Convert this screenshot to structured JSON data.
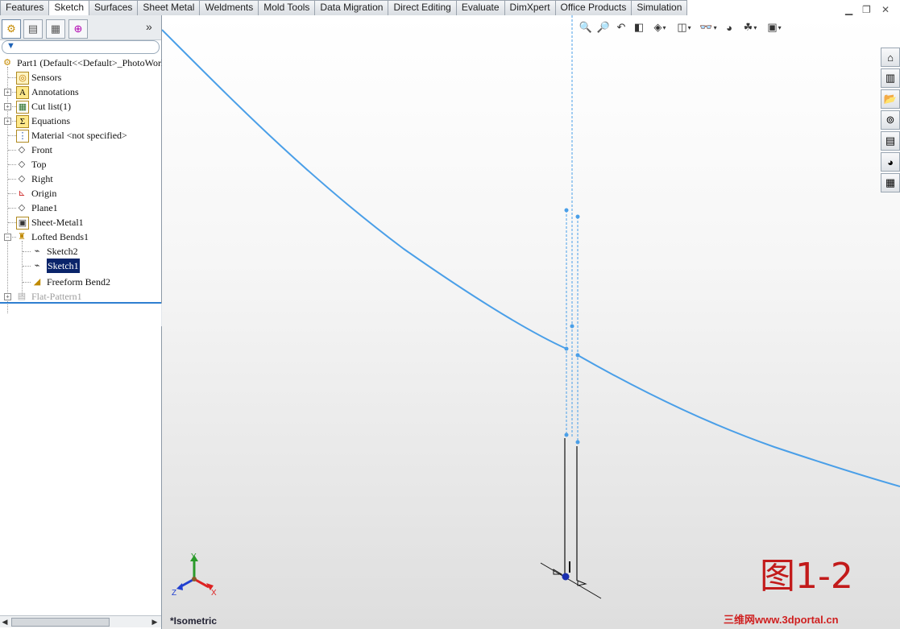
{
  "command_manager": {
    "tabs": [
      "Features",
      "Sketch",
      "Surfaces",
      "Sheet Metal",
      "Weldments",
      "Mold Tools",
      "Data Migration",
      "Direct Editing",
      "Evaluate",
      "DimXpert",
      "Office Products",
      "Simulation"
    ],
    "active_tab": "Sketch"
  },
  "panel": {
    "tabs": [
      "featuremanager-icon",
      "propertymanager-icon",
      "configurationmanager-icon",
      "dimxpert-icon"
    ],
    "more": "»",
    "filter_icon": "funnel-icon"
  },
  "tree": {
    "root": "Part1  (Default<<Default>_PhotoWorl",
    "items": [
      {
        "label": "Sensors",
        "icon": "sensors-icon",
        "expand": false
      },
      {
        "label": "Annotations",
        "icon": "annotations-icon",
        "expand": true
      },
      {
        "label": "Cut list(1)",
        "icon": "cut-list-icon",
        "expand": true
      },
      {
        "label": "Equations",
        "icon": "equations-icon",
        "expand": true
      },
      {
        "label": "Material <not specified>",
        "icon": "material-icon",
        "expand": false
      },
      {
        "label": "Front",
        "icon": "plane-icon",
        "expand": false
      },
      {
        "label": "Top",
        "icon": "plane-icon",
        "expand": false
      },
      {
        "label": "Right",
        "icon": "plane-icon",
        "expand": false
      },
      {
        "label": "Origin",
        "icon": "origin-icon",
        "expand": false
      },
      {
        "label": "Plane1",
        "icon": "plane-icon",
        "expand": false
      },
      {
        "label": "Sheet-Metal1",
        "icon": "sheet-metal-icon",
        "expand": false
      },
      {
        "label": "Lofted Bends1",
        "icon": "lofted-bends-icon",
        "expand": true
      }
    ],
    "children": [
      {
        "label": "Sketch2",
        "icon": "sketch-icon"
      },
      {
        "label": "Sketch1",
        "icon": "sketch-icon",
        "selected": true
      },
      {
        "label": "Freeform Bend2",
        "icon": "freeform-bend-icon"
      }
    ],
    "suppressed": {
      "label": "Flat-Pattern1",
      "icon": "flat-pattern-icon"
    }
  },
  "heads_up_toolbar": [
    "zoom-to-fit-icon",
    "zoom-to-area-icon",
    "previous-view-icon",
    "section-view-icon",
    "view-orientation-icon",
    "display-style-icon",
    "hide-show-items-icon",
    "edit-appearance-icon",
    "apply-scene-icon",
    "view-settings-icon"
  ],
  "task_pane": [
    "resources-icon",
    "design-library-icon",
    "file-explorer-icon",
    "search-icon",
    "view-palette-icon",
    "appearances-icon",
    "custom-properties-icon"
  ],
  "triad": {
    "x": "X",
    "y": "Y",
    "z": "Z"
  },
  "view_label": "*Isometric",
  "figure_label": "图1-2",
  "watermark": "三维网www.3dportal.cn",
  "colors": {
    "curve": "#4a9fe8",
    "selection": "#0a246a",
    "figure_label": "#c21a1a"
  }
}
